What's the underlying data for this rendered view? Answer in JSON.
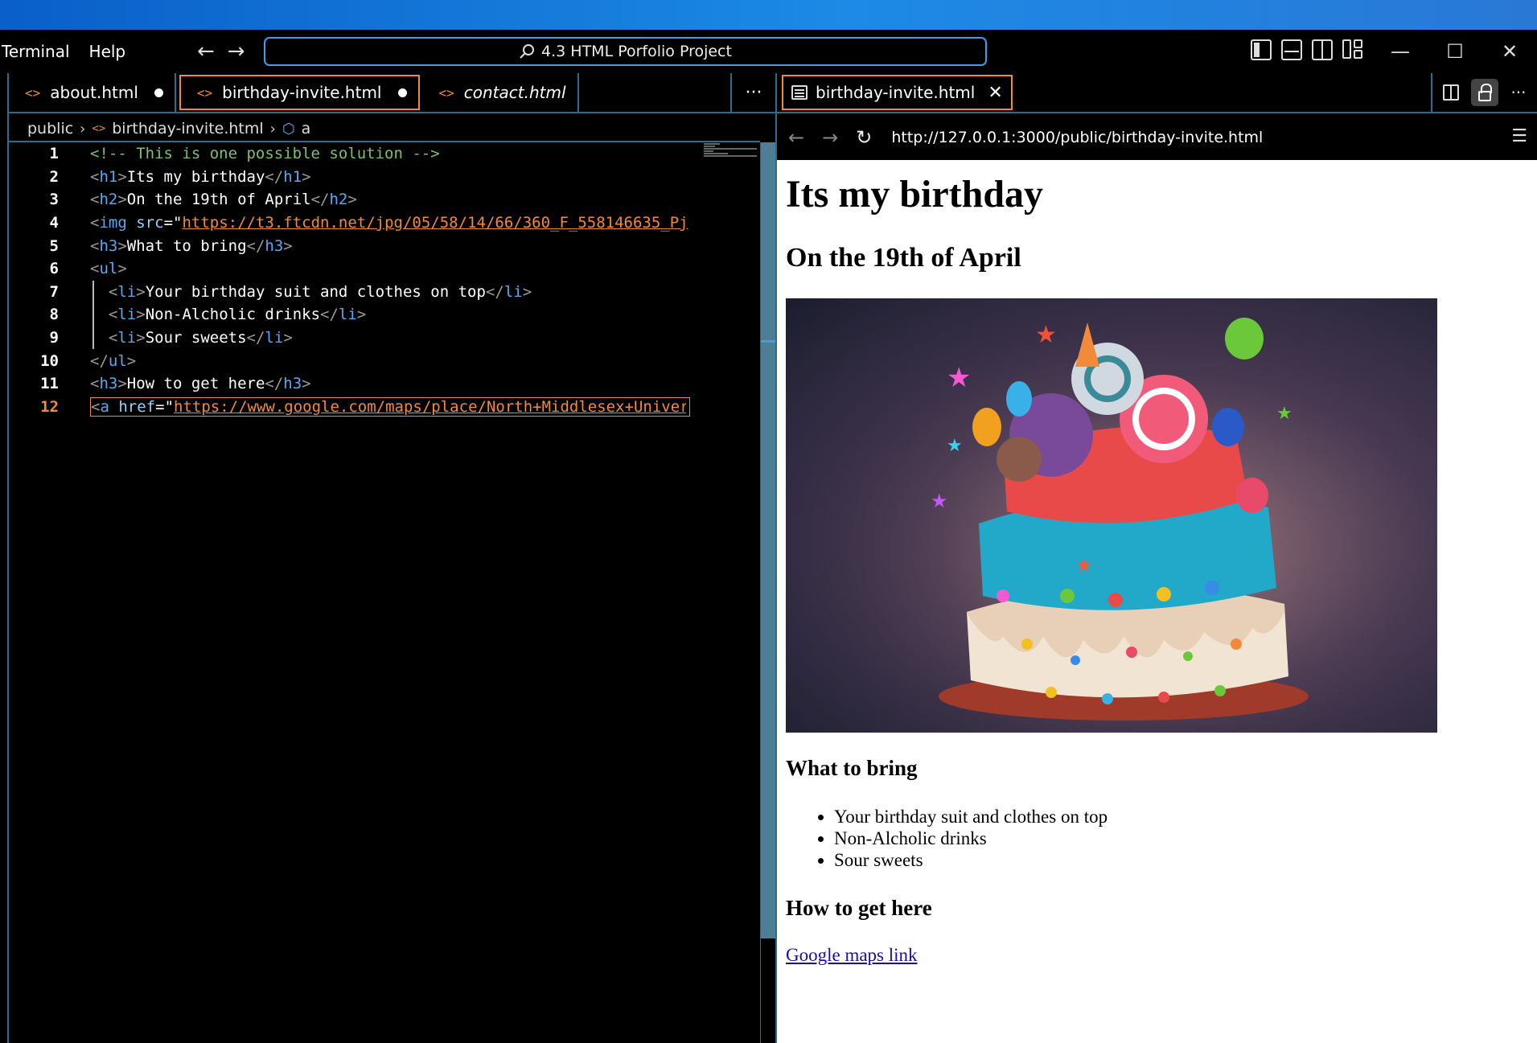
{
  "titlebar": {
    "menu": [
      "Terminal",
      "Help"
    ],
    "command_center": "4.3 HTML Porfolio Project"
  },
  "editor": {
    "tabs": [
      {
        "label": "about.html",
        "dirty": true
      },
      {
        "label": "birthday-invite.html",
        "dirty": true,
        "active": true
      },
      {
        "label": "contact.html",
        "italic": true
      }
    ],
    "more_label": "···",
    "breadcrumb": {
      "folder": "public",
      "file": "birthday-invite.html",
      "symbol": "a"
    },
    "line_numbers": [
      "1",
      "2",
      "3",
      "4",
      "5",
      "6",
      "7",
      "8",
      "9",
      "10",
      "11",
      "12"
    ],
    "lines": {
      "l1_comment": "<!-- This is one possible solution -->",
      "l2_text": "Its my birthday",
      "l3_text": "On the 19th of April",
      "l4_attr": "src",
      "l4_url": "https://t3.ftcdn.net/jpg/05/58/14/66/360_F_558146635_Pj",
      "l5_text": "What to bring",
      "l7_text": "Your birthday suit and clothes on top",
      "l8_text": "Non-Alcholic drinks",
      "l9_text": "Sour sweets",
      "l11_text": "How to get here",
      "l12_attr": "href",
      "l12_url": "https://www.google.com/maps/place/North+Middlesex+Univers"
    }
  },
  "preview": {
    "tab_label": "birthday-invite.html",
    "url": "http://127.0.0.1:3000/public/birthday-invite.html",
    "page": {
      "h1": "Its my birthday",
      "h2": "On the 19th of April",
      "h3_bring": "What to bring",
      "items": [
        "Your birthday suit and clothes on top",
        "Non-Alcholic drinks",
        "Sour sweets"
      ],
      "h3_directions": "How to get here",
      "link": "Google maps link"
    }
  },
  "colors": {
    "accent_orange": "#f08a3c",
    "border_teal": "#2b6d8c",
    "tag_blue": "#5aa8f0",
    "comment_green": "#7fc06b",
    "link_blue": "#1a0dab"
  },
  "icons": [
    "search-icon",
    "code-file-icon",
    "cube-icon",
    "preview-icon",
    "close-icon",
    "split-editor-icon",
    "lock-icon",
    "more-icon",
    "back-arrow-icon",
    "forward-arrow-icon",
    "reload-icon",
    "menu-icon"
  ]
}
